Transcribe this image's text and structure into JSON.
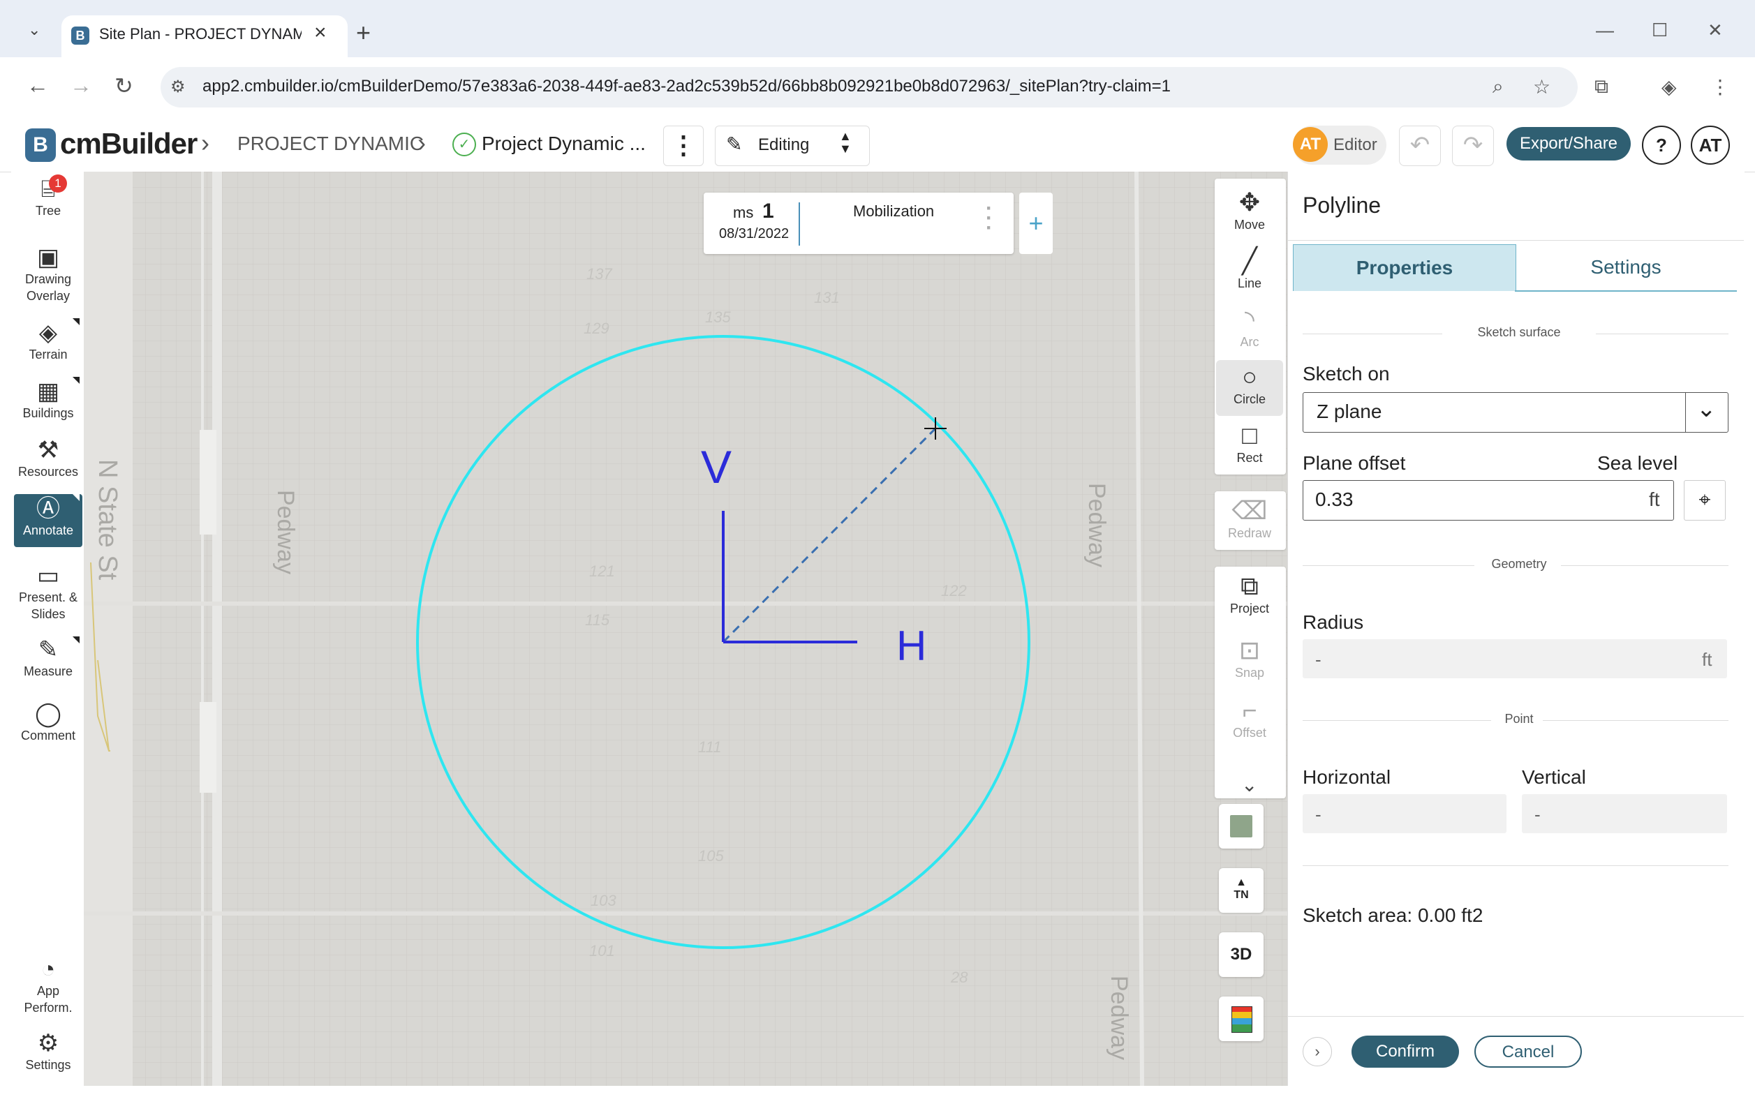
{
  "browser": {
    "tab_title": "Site Plan - PROJECT DYNAMIC |",
    "tab_icon_letter": "B",
    "url": "app2.cmbuilder.io/cmBuilderDemo/57e383a6-2038-449f-ae83-2ad2c539b52d/66bb8b092921be0b8d072963/_sitePlan?try-claim=1"
  },
  "header": {
    "logo_letter": "B",
    "logo_text": "cmBuilder",
    "breadcrumb_project": "PROJECT DYNAMIC",
    "breadcrumb_plan": "Project Dynamic ...",
    "mode_label": "Editing",
    "user_initials": "AT",
    "role_label": "Editor",
    "export_label": "Export/Share",
    "help_label": "?",
    "profile_initials": "AT"
  },
  "sidebar": {
    "tree_badge": "1",
    "items": [
      {
        "label": "Tree",
        "icon": "tree-icon"
      },
      {
        "label": "Drawing Overlay",
        "icon": "image-icon"
      },
      {
        "label": "Terrain",
        "icon": "terrain-icon"
      },
      {
        "label": "Buildings",
        "icon": "buildings-icon"
      },
      {
        "label": "Resources",
        "icon": "resources-icon"
      },
      {
        "label": "Annotate",
        "icon": "annotate-icon"
      },
      {
        "label": "Present. & Slides",
        "icon": "presentation-icon"
      },
      {
        "label": "Measure",
        "icon": "ruler-icon"
      },
      {
        "label": "Comment",
        "icon": "comment-icon"
      },
      {
        "label": "App Perform.",
        "icon": "gauge-icon"
      },
      {
        "label": "Settings",
        "icon": "gear-icon"
      }
    ]
  },
  "milestone": {
    "prefix": "ms",
    "number": "1",
    "date": "08/31/2022",
    "name": "Mobilization"
  },
  "map": {
    "street_labels": [
      "N State St",
      "Pedway",
      "Pedway",
      "Pedway"
    ],
    "axis_v": "V",
    "axis_h": "H",
    "circle_color": "#2ee6f0",
    "axis_color": "#2b2bd9",
    "contour_labels": [
      "137",
      "135",
      "131",
      "129",
      "121",
      "122",
      "115",
      "111",
      "105",
      "103",
      "101",
      "28"
    ]
  },
  "tools": {
    "move": "Move",
    "line": "Line",
    "arc": "Arc",
    "circle": "Circle",
    "rect": "Rect",
    "redraw": "Redraw",
    "project": "Project",
    "snap": "Snap",
    "offset": "Offset",
    "tn_label": "TN",
    "threed_label": "3D"
  },
  "panel": {
    "title": "Polyline",
    "tab_properties": "Properties",
    "tab_settings": "Settings",
    "section_surface": "Sketch surface",
    "sketch_on_label": "Sketch on",
    "sketch_on_value": "Z plane",
    "plane_offset_label": "Plane offset",
    "sea_level_label": "Sea level",
    "plane_offset_value": "0.33",
    "plane_offset_unit": "ft",
    "section_geometry": "Geometry",
    "radius_label": "Radius",
    "radius_value": "-",
    "radius_unit": "ft",
    "section_point": "Point",
    "horizontal_label": "Horizontal",
    "horizontal_value": "-",
    "vertical_label": "Vertical",
    "vertical_value": "-",
    "sketch_area": "Sketch area: 0.00 ft2",
    "confirm_label": "Confirm",
    "cancel_label": "Cancel"
  },
  "colors": {
    "accent": "#2f5f72",
    "tab_active_bg": "#cde7ef",
    "map_bg": "#d8d7d3"
  }
}
